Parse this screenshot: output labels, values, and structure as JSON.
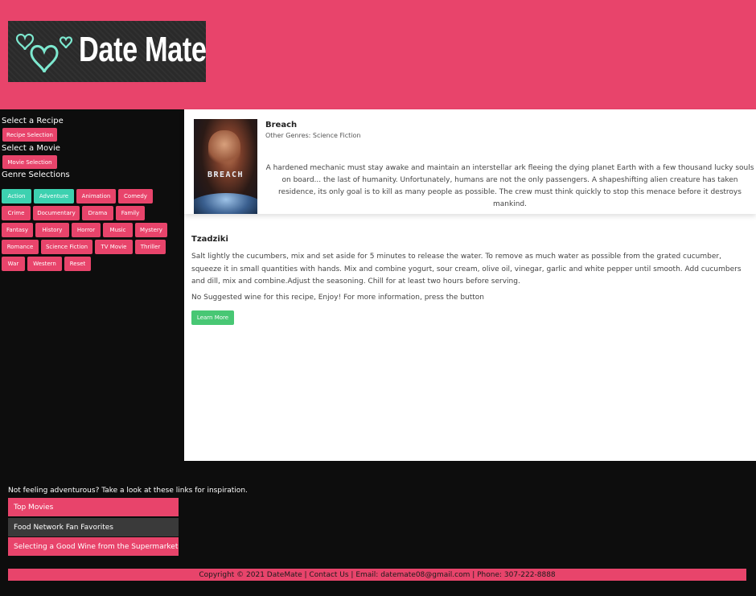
{
  "brand": {
    "name": "Date Mate",
    "accent": "#e8446b",
    "teal": "#3dd1b0",
    "green": "#48c774"
  },
  "sidebar": {
    "recipe_heading": "Select a Recipe",
    "recipe_button": "Recipe Selection",
    "movie_heading": "Select a Movie",
    "movie_button": "Movie Selection",
    "genre_heading": "Genre Selections",
    "genres": [
      {
        "label": "Action",
        "active": true
      },
      {
        "label": "Adventure",
        "active": true
      },
      {
        "label": "Animation",
        "active": false
      },
      {
        "label": "Comedy",
        "active": false
      },
      {
        "label": "Crime",
        "active": false
      },
      {
        "label": "Documentary",
        "active": false
      },
      {
        "label": "Drama",
        "active": false
      },
      {
        "label": "Family",
        "active": false
      },
      {
        "label": "Fantasy",
        "active": false
      },
      {
        "label": "History",
        "active": false
      },
      {
        "label": "Horror",
        "active": false
      },
      {
        "label": "Music",
        "active": false
      },
      {
        "label": "Mystery",
        "active": false
      },
      {
        "label": "Romance",
        "active": false
      },
      {
        "label": "Science Fiction",
        "active": false
      },
      {
        "label": "TV Movie",
        "active": false
      },
      {
        "label": "Thriller",
        "active": false
      },
      {
        "label": "War",
        "active": false
      },
      {
        "label": "Western",
        "active": false
      },
      {
        "label": "Reset",
        "active": false
      }
    ]
  },
  "movie": {
    "poster_text": "BREACH",
    "title": "Breach",
    "other_genres": "Other Genres: Science Fiction",
    "description": "A hardened mechanic must stay awake and maintain an interstellar ark fleeing the dying planet Earth with a few thousand lucky souls on board... the last of humanity. Unfortunately, humans are not the only passengers. A shapeshifting alien creature has taken residence, its only goal is to kill as many people as possible. The crew must think quickly to stop this menace before it destroys mankind."
  },
  "recipe": {
    "title": "Tzadziki",
    "description": "Salt lightly the cucumbers, mix and set aside for 5 minutes to release the water. To remove as much water as possible from the grated cucumber, squeeze it in small quantities with hands. Mix and combine yogurt, sour cream, olive oil, vinegar, garlic and white pepper until smooth. Add cucumbers and dill, mix and combine.Adjust the seasoning. Chill for at least two hours before serving.",
    "wine_note": "No Suggested wine for this recipe, Enjoy! For more information, press the button",
    "learn_more": "Learn More"
  },
  "footer": {
    "inspiration_text": "Not feeling adventurous? Take a look at these links for inspiration.",
    "links": [
      {
        "label": "Top Movies",
        "color": "#e8446b"
      },
      {
        "label": "Food Network Fan Favorites",
        "color": "#3a3a3a"
      },
      {
        "label": "Selecting a Good Wine from the Supermarket",
        "color": "#e8446b"
      }
    ],
    "copyright": "Copyright © 2021 DateMate | Contact Us | Email: datemate08@gmail.com | Phone: 307-222-8888"
  }
}
